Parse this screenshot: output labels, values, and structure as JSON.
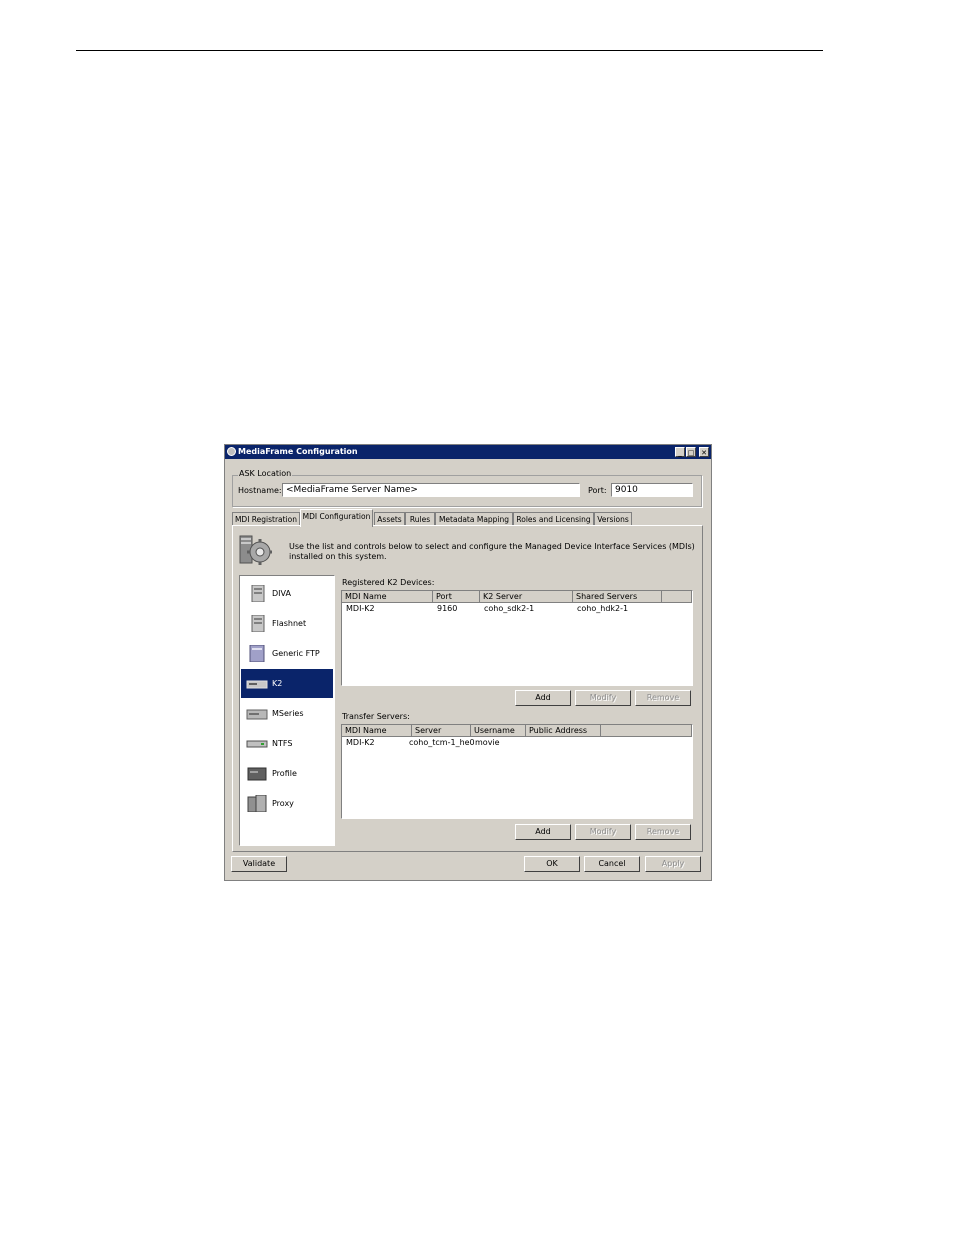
{
  "window": {
    "title": "MediaFrame Configuration",
    "minimize": "_",
    "maximize": "□",
    "close": "✕"
  },
  "ask_location": {
    "group_label": "ASK Location",
    "hostname_label": "Hostname:",
    "hostname_value": "<MediaFrame Server Name>",
    "port_label": "Port:",
    "port_value": "9010"
  },
  "tabs": [
    "MDI Registration",
    "MDI Configuration",
    "Assets",
    "Rules",
    "Metadata Mapping",
    "Roles and Licensing",
    "Versions"
  ],
  "active_tab": "MDI Configuration",
  "description": "Use the list and controls below to select and configure the Managed Device Interface Services (MDIs) installed on this system.",
  "devices": [
    {
      "label": "DIVA",
      "icon": "server-icon"
    },
    {
      "label": "Flashnet",
      "icon": "server-icon"
    },
    {
      "label": "Generic FTP",
      "icon": "ftp-server-icon"
    },
    {
      "label": "K2",
      "icon": "k2-device-icon"
    },
    {
      "label": "MSeries",
      "icon": "mseries-device-icon"
    },
    {
      "label": "NTFS",
      "icon": "drive-icon"
    },
    {
      "label": "Profile",
      "icon": "profile-device-icon"
    },
    {
      "label": "Proxy",
      "icon": "proxy-server-icon"
    }
  ],
  "selected_device": "K2",
  "registered": {
    "label": "Registered K2 Devices:",
    "columns": [
      "MDI Name",
      "Port",
      "K2 Server",
      "Shared Servers"
    ],
    "rows": [
      [
        "MDI-K2",
        "9160",
        "coho_sdk2-1",
        "coho_hdk2-1"
      ]
    ],
    "buttons": {
      "add": "Add",
      "modify": "Modify",
      "remove": "Remove"
    }
  },
  "transfer": {
    "label": "Transfer Servers:",
    "columns": [
      "MDI Name",
      "Server",
      "Username",
      "Public Address"
    ],
    "rows": [
      [
        "MDI-K2",
        "coho_tcm-1_he0",
        "movie",
        ""
      ]
    ],
    "buttons": {
      "add": "Add",
      "modify": "Modify",
      "remove": "Remove"
    }
  },
  "footer": {
    "validate": "Validate",
    "ok": "OK",
    "cancel": "Cancel",
    "apply": "Apply"
  }
}
